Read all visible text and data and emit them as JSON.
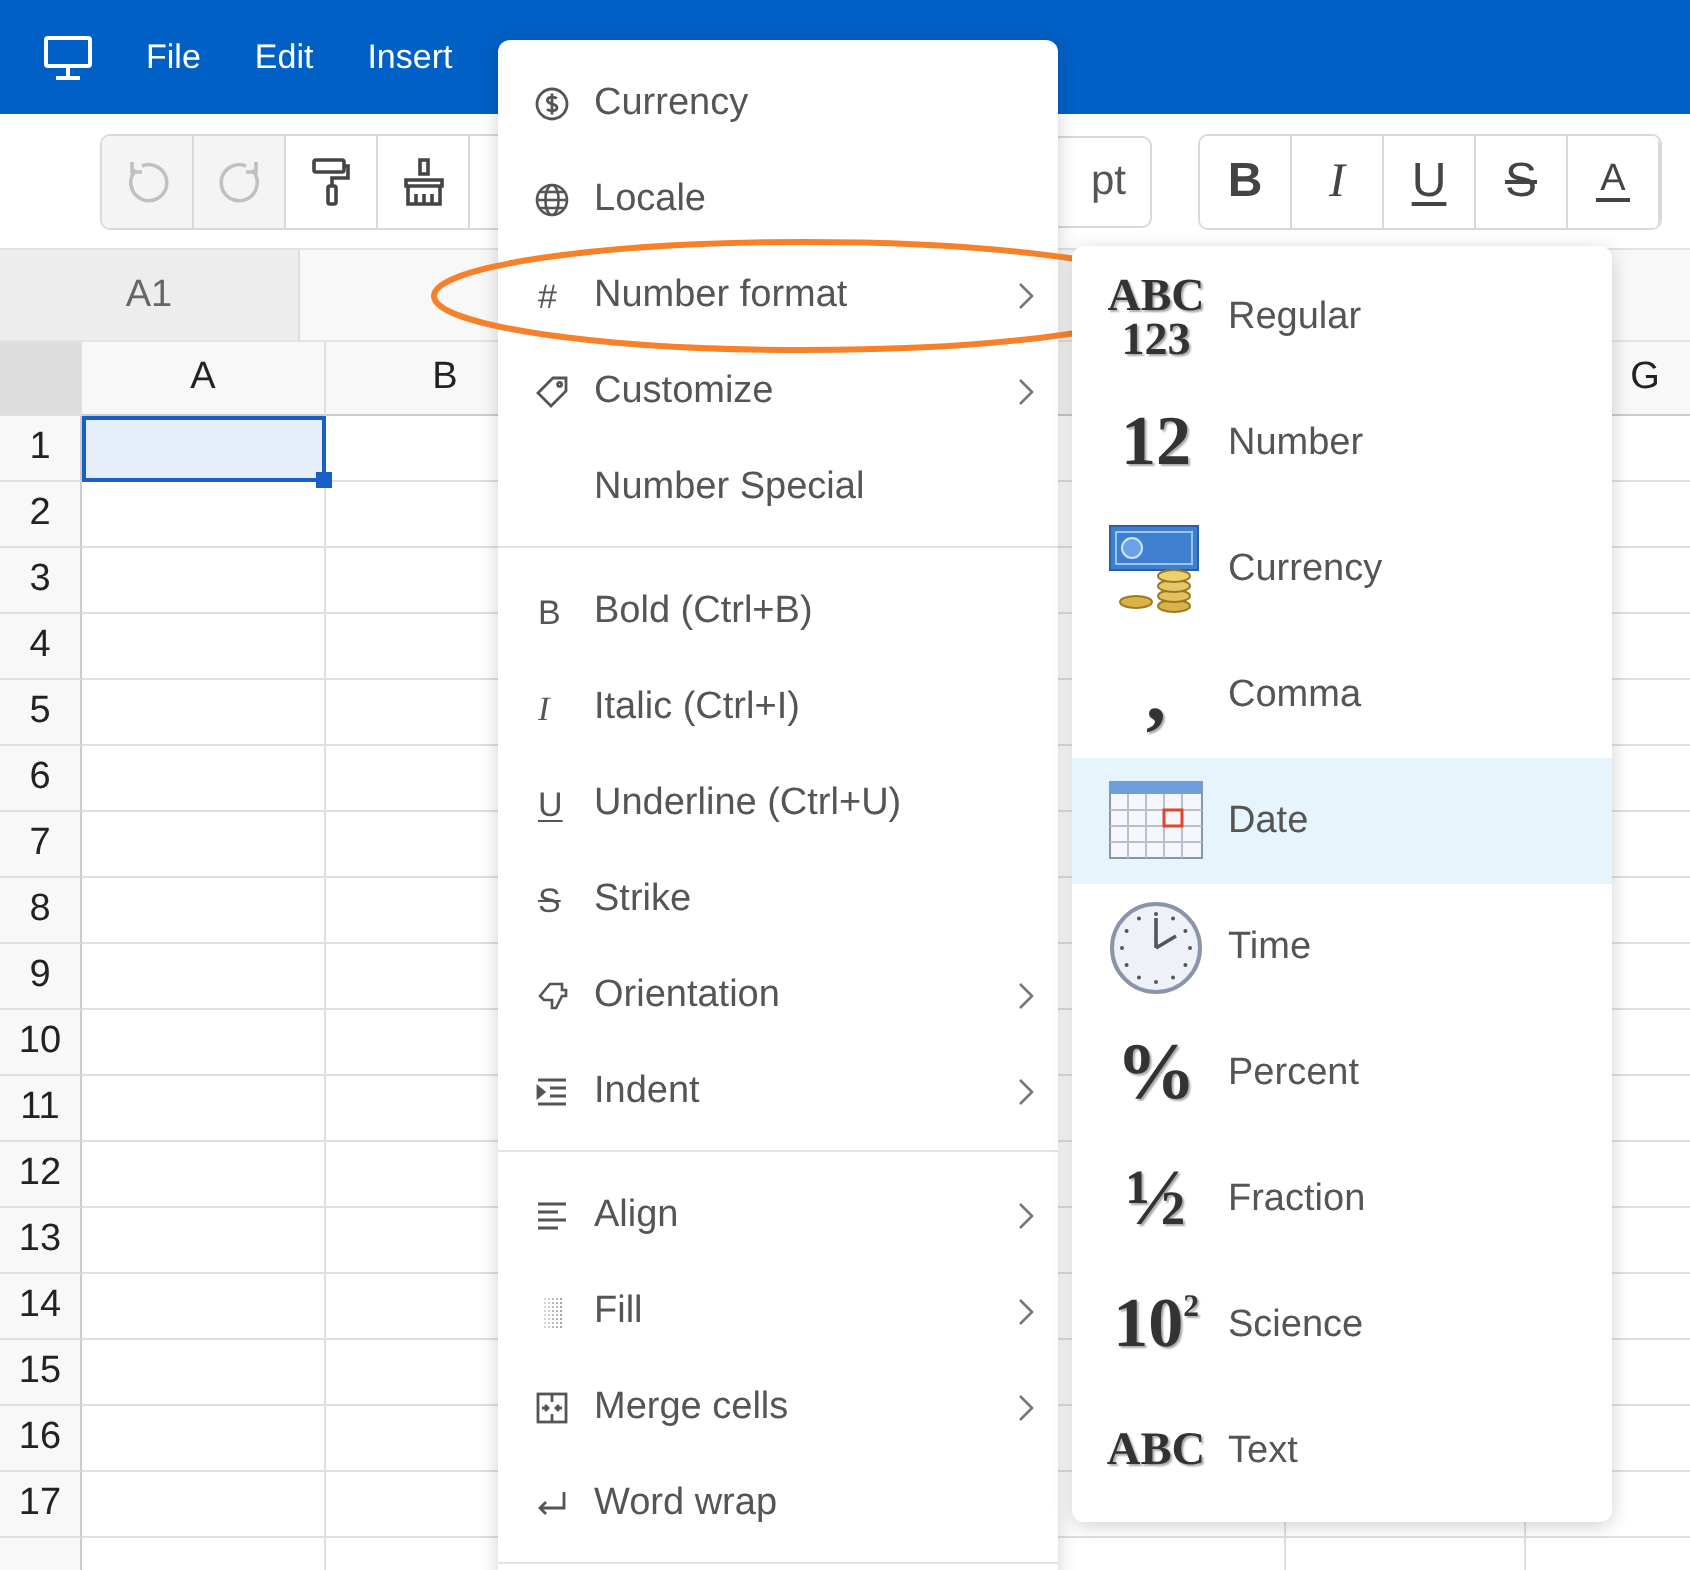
{
  "menubar": {
    "items": [
      "File",
      "Edit",
      "Insert"
    ]
  },
  "toolbar": {
    "history": [
      {
        "disabled": true
      },
      {
        "disabled": true
      },
      {
        "disabled": false
      },
      {
        "disabled": false
      }
    ],
    "font_size": {
      "value": "pt"
    },
    "text_style": [
      {
        "glyph": "B"
      },
      {
        "glyph": "I"
      },
      {
        "glyph": "U"
      },
      {
        "glyph": "S"
      },
      {
        "glyph": "A"
      }
    ]
  },
  "name_box": "A1",
  "sheet": {
    "columns": [
      {
        "label": "A"
      },
      {
        "label": "B"
      },
      {
        "label": "G"
      }
    ],
    "rows": [
      {
        "label": "1",
        "cells": [
          {
            "selected": true
          }
        ]
      },
      {
        "label": "2"
      },
      {
        "label": "3"
      },
      {
        "label": "4"
      },
      {
        "label": "5"
      },
      {
        "label": "6"
      },
      {
        "label": "7"
      },
      {
        "label": "8"
      },
      {
        "label": "9"
      },
      {
        "label": "10"
      },
      {
        "label": "11"
      },
      {
        "label": "12"
      },
      {
        "label": "13"
      },
      {
        "label": "14"
      },
      {
        "label": "15"
      },
      {
        "label": "16"
      },
      {
        "label": "17"
      }
    ]
  },
  "context_menu": {
    "sections": [
      [
        {
          "label": "Currency",
          "submenu": false,
          "circled": false
        },
        {
          "label": "Locale",
          "submenu": false,
          "circled": false
        },
        {
          "label": "Number format",
          "glyph": "#",
          "submenu": true,
          "circled": true
        },
        {
          "label": "Customize",
          "submenu": true,
          "circled": false
        },
        {
          "label": "Number Special",
          "submenu": false,
          "circled": false
        }
      ],
      [
        {
          "label": "Bold (Ctrl+B)",
          "glyph": "B",
          "submenu": false,
          "circled": false
        },
        {
          "label": "Italic (Ctrl+I)",
          "glyph": "I",
          "submenu": false,
          "circled": false
        },
        {
          "label": "Underline (Ctrl+U)",
          "glyph": "U",
          "submenu": false,
          "circled": false
        },
        {
          "label": "Strike",
          "glyph": "S",
          "submenu": false,
          "circled": false
        },
        {
          "label": "Orientation",
          "submenu": true,
          "circled": false
        },
        {
          "label": "Indent",
          "submenu": true,
          "circled": false
        }
      ],
      [
        {
          "label": "Align",
          "submenu": true,
          "circled": false
        },
        {
          "label": "Fill",
          "submenu": true,
          "circled": false
        },
        {
          "label": "Merge cells",
          "submenu": true,
          "circled": false
        },
        {
          "label": "Word wrap",
          "submenu": false,
          "circled": false
        }
      ]
    ]
  },
  "submenu": {
    "items": [
      {
        "label": "Regular",
        "glyph": [
          "ABC",
          "123"
        ],
        "selected": false
      },
      {
        "label": "Number",
        "glyph": [
          "12"
        ],
        "selected": false
      },
      {
        "label": "Currency",
        "selected": false
      },
      {
        "label": "Comma",
        "glyph": [
          ","
        ],
        "selected": false
      },
      {
        "label": "Date",
        "selected": true
      },
      {
        "label": "Time",
        "selected": false
      },
      {
        "label": "Percent",
        "glyph": [
          "%"
        ],
        "selected": false
      },
      {
        "label": "Fraction",
        "glyph": [
          "½"
        ],
        "selected": false
      },
      {
        "label": "Science",
        "glyph": [
          "10$^{2}$"
        ],
        "selected": false
      },
      {
        "label": "Text",
        "glyph": [
          "ABC"
        ],
        "selected": false
      }
    ]
  }
}
